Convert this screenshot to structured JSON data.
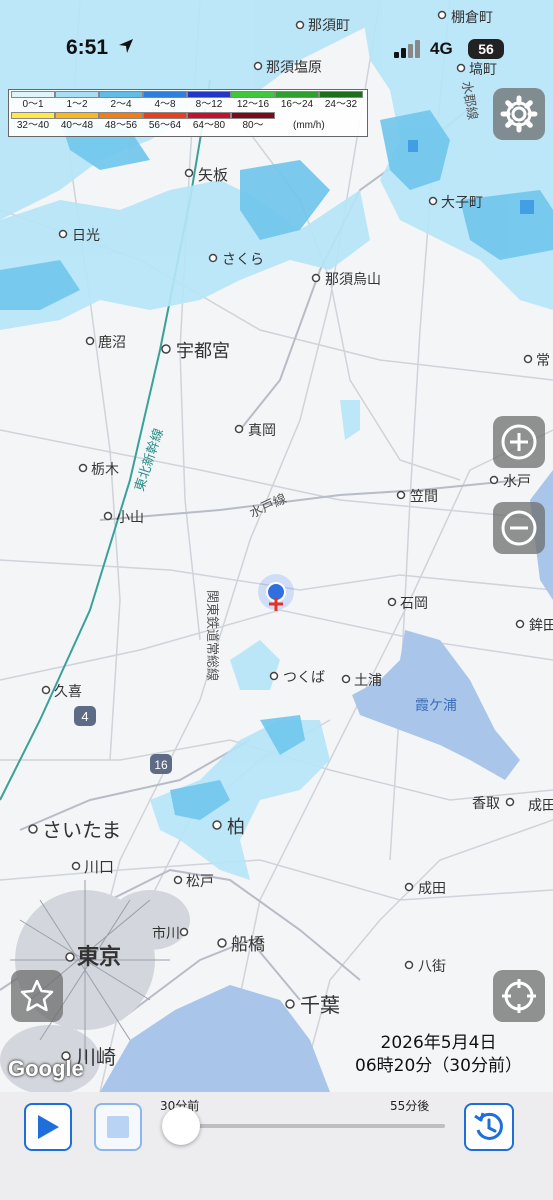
{
  "status_bar": {
    "time": "6:51",
    "network": "4G",
    "battery": "56"
  },
  "legend": {
    "row1": [
      {
        "label": "0～1",
        "color": "#dff3fb"
      },
      {
        "label": "1～2",
        "color": "#a8def5"
      },
      {
        "label": "2～4",
        "color": "#5fbde8"
      },
      {
        "label": "4～8",
        "color": "#2f7fe0"
      },
      {
        "label": "8～12",
        "color": "#2236c8"
      },
      {
        "label": "12～16",
        "color": "#3fc83c"
      },
      {
        "label": "16～24",
        "color": "#2ea02e"
      },
      {
        "label": "24～32",
        "color": "#1d6f1d"
      }
    ],
    "row2": [
      {
        "label": "32～40",
        "color": "#ffe94a"
      },
      {
        "label": "40～48",
        "color": "#f7b820"
      },
      {
        "label": "48～56",
        "color": "#ef7e14"
      },
      {
        "label": "56～64",
        "color": "#ee3b1a"
      },
      {
        "label": "64～80",
        "color": "#c8102e"
      },
      {
        "label": "80～",
        "color": "#7a0a1e"
      }
    ],
    "unit": "(mm/h)"
  },
  "map": {
    "places": [
      {
        "name": "那須町",
        "big": false
      },
      {
        "name": "棚倉町",
        "big": false
      },
      {
        "name": "那須塩原",
        "big": false
      },
      {
        "name": "塙町",
        "big": false
      },
      {
        "name": "矢板",
        "big": false
      },
      {
        "name": "大子町",
        "big": false
      },
      {
        "name": "日光",
        "big": false
      },
      {
        "name": "さくら",
        "big": false
      },
      {
        "name": "那須烏山",
        "big": false
      },
      {
        "name": "鹿沼",
        "big": false
      },
      {
        "name": "宇都宮",
        "big": true
      },
      {
        "name": "常",
        "big": false
      },
      {
        "name": "真岡",
        "big": false
      },
      {
        "name": "栃木",
        "big": false
      },
      {
        "name": "水戸",
        "big": false
      },
      {
        "name": "笠間",
        "big": false
      },
      {
        "name": "小山",
        "big": false
      },
      {
        "name": "石岡",
        "big": false
      },
      {
        "name": "鉾田",
        "big": false
      },
      {
        "name": "つくば",
        "big": false
      },
      {
        "name": "土浦",
        "big": false
      },
      {
        "name": "久喜",
        "big": false
      },
      {
        "name": "香取",
        "big": false
      },
      {
        "name": "成田",
        "big": false
      },
      {
        "name": "さいたま",
        "big": true
      },
      {
        "name": "柏",
        "big": true
      },
      {
        "name": "川口",
        "big": false
      },
      {
        "name": "松戸",
        "big": false
      },
      {
        "name": "成田",
        "big": false
      },
      {
        "name": "市川",
        "big": false
      },
      {
        "name": "船橋",
        "big": true
      },
      {
        "name": "東京",
        "big": true
      },
      {
        "name": "八街",
        "big": false
      },
      {
        "name": "千葉",
        "big": true
      },
      {
        "name": "川崎",
        "big": true
      }
    ],
    "lines": [
      "東北新幹線",
      "水戸線",
      "関東鉄道常総線",
      "水郡線"
    ],
    "water": [
      "霞ケ浦"
    ],
    "route_shields": [
      "4",
      "16"
    ]
  },
  "controls": {
    "settings": "gear-icon",
    "zoom_in": "plus-icon",
    "zoom_out": "minus-icon",
    "favorite": "star-icon",
    "locate": "crosshair-icon"
  },
  "attribution": "Google",
  "timestamp": {
    "date": "2026年5月4日",
    "time": "06時20分（30分前）"
  },
  "player": {
    "slider_left_label": "30分前",
    "slider_right_label": "55分後",
    "slider_position": 0.0
  },
  "colors": {
    "accent": "#1e6fd9",
    "rain_light": "#a8def5",
    "water": "#a9c6ea"
  }
}
